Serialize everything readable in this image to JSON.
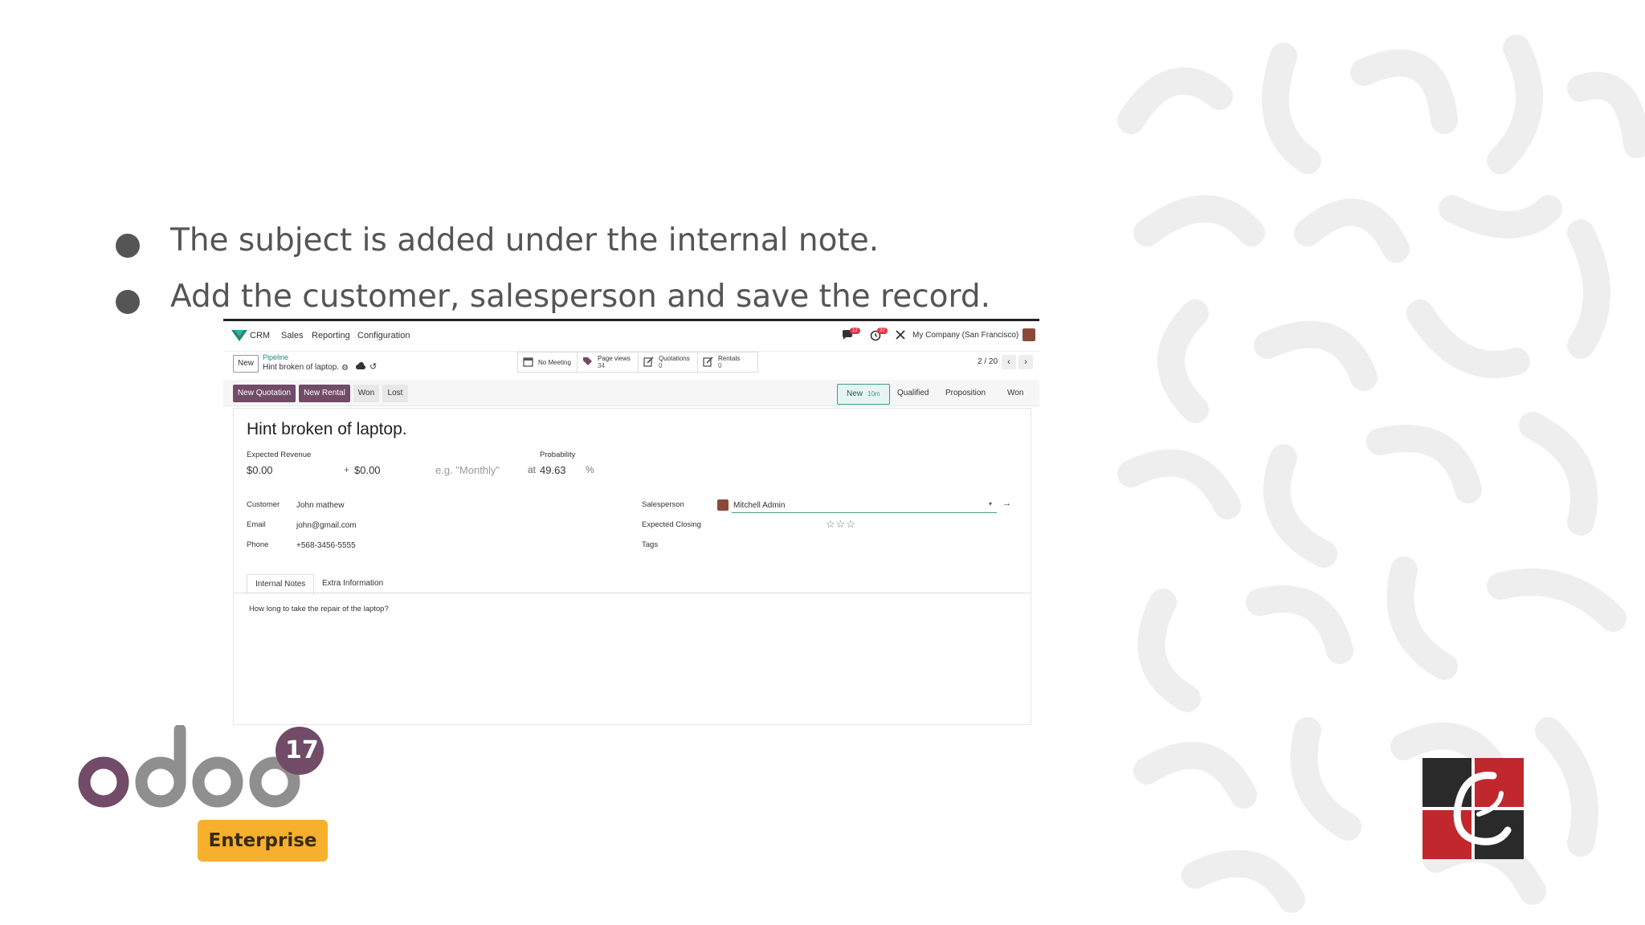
{
  "slide": {
    "bullets": [
      "The subject is added under the internal note.",
      "Add the customer, salesperson and save the record."
    ]
  },
  "topbar": {
    "app": "CRM",
    "menu": [
      "Sales",
      "Reporting",
      "Configuration"
    ],
    "messages_badge": "12",
    "activities_badge": "32",
    "company": "My Company (San Francisco)"
  },
  "control": {
    "new_label": "New",
    "breadcrumb_parent": "Pipeline",
    "breadcrumb_current": "Hint broken of laptop.",
    "stats": [
      {
        "label": "No Meeting",
        "value": ""
      },
      {
        "label": "Page views",
        "value": "34"
      },
      {
        "label": "Quotations",
        "value": "0"
      },
      {
        "label": "Rentals",
        "value": "0"
      }
    ],
    "pager": "2 / 20"
  },
  "actions": {
    "new_quotation": "New Quotation",
    "new_rental": "New Rental",
    "won": "Won",
    "lost": "Lost"
  },
  "stages": {
    "new": "New",
    "new_duration": "10m",
    "qualified": "Qualified",
    "proposition": "Proposition",
    "won": "Won"
  },
  "form": {
    "title": "Hint broken of laptop.",
    "expected_revenue_label": "Expected Revenue",
    "expected_revenue": "$0.00",
    "plus": "+",
    "recurring_revenue": "$0.00",
    "recurring_placeholder": "e.g. \"Monthly\"",
    "probability_label": "Probability",
    "at": "at",
    "probability": "49.63",
    "percent": "%",
    "customer_label": "Customer",
    "customer": "John mathew",
    "email_label": "Email",
    "email": "john@gmail.com",
    "phone_label": "Phone",
    "phone": "+568-3456-5555",
    "salesperson_label": "Salesperson",
    "salesperson": "Mitchell Admin",
    "expected_closing_label": "Expected Closing",
    "tags_label": "Tags",
    "priority_stars": 0
  },
  "tabs": {
    "internal_notes": "Internal Notes",
    "extra_information": "Extra Information"
  },
  "notes": {
    "text": "How long to take the repair of the laptop?"
  },
  "branding": {
    "odoo_version": "17",
    "edition": "Enterprise",
    "odoo_purple": "#714b67",
    "odoo_grey": "#8f8f8f",
    "enterprise_color": "#f6b02e",
    "cybrosys_red": "#c0282d"
  }
}
